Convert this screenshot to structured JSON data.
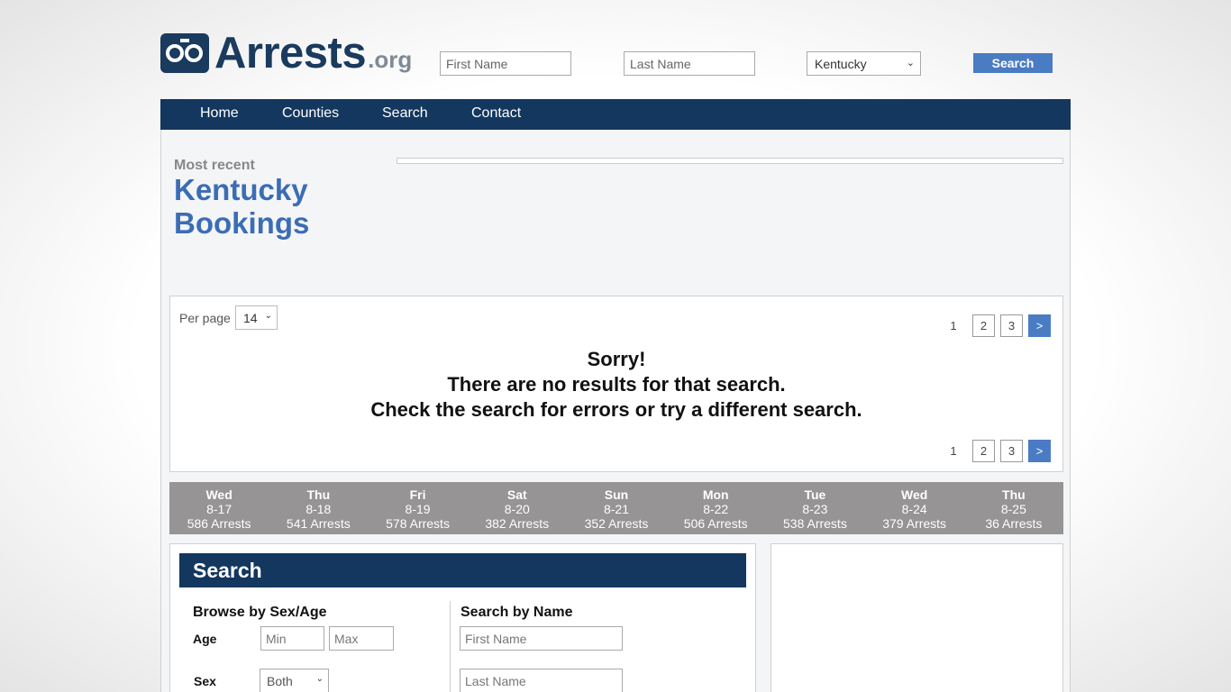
{
  "header": {
    "logo_text": "Arrests",
    "logo_tld": ".org",
    "first_name_placeholder": "First Name",
    "last_name_placeholder": "Last Name",
    "state_selected": "Kentucky",
    "search_label": "Search"
  },
  "nav": {
    "items": [
      "Home",
      "Counties",
      "Search",
      "Contact"
    ]
  },
  "hero": {
    "subtitle": "Most recent",
    "title": "Kentucky Bookings"
  },
  "results": {
    "per_page_label": "Per page",
    "per_page_value": "14",
    "pager": {
      "current": "1",
      "pages": [
        "2",
        "3"
      ],
      "next": ">"
    },
    "message": [
      "Sorry!",
      "There are no results for that search.",
      "Check the search for errors or try a different search."
    ]
  },
  "days": [
    {
      "day": "Wed",
      "date": "8-17",
      "count": "586 Arrests"
    },
    {
      "day": "Thu",
      "date": "8-18",
      "count": "541 Arrests"
    },
    {
      "day": "Fri",
      "date": "8-19",
      "count": "578 Arrests"
    },
    {
      "day": "Sat",
      "date": "8-20",
      "count": "382 Arrests"
    },
    {
      "day": "Sun",
      "date": "8-21",
      "count": "352 Arrests"
    },
    {
      "day": "Mon",
      "date": "8-22",
      "count": "506 Arrests"
    },
    {
      "day": "Tue",
      "date": "8-23",
      "count": "538 Arrests"
    },
    {
      "day": "Wed",
      "date": "8-24",
      "count": "379 Arrests"
    },
    {
      "day": "Thu",
      "date": "8-25",
      "count": "36 Arrests"
    }
  ],
  "search_panel": {
    "title": "Search",
    "browse_title": "Browse by Sex/Age",
    "age_label": "Age",
    "min_placeholder": "Min",
    "max_placeholder": "Max",
    "sex_label": "Sex",
    "sex_selected": "Both",
    "name_title": "Search by Name",
    "first_name_placeholder": "First Name",
    "last_name_placeholder": "Last Name"
  },
  "colors": {
    "nav_bg": "#13375f",
    "accent_blue": "#4a7cc4",
    "title_blue": "#3b6db5",
    "days_bg": "#969494"
  }
}
